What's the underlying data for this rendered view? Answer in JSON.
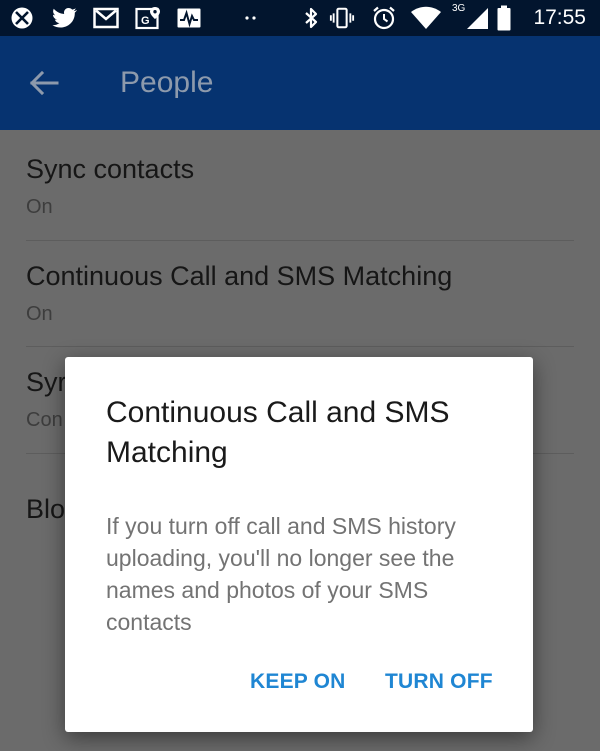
{
  "status_bar": {
    "time": "17:55",
    "network": "3G",
    "left_icons": [
      "xbox-icon",
      "twitter-icon",
      "gmail-icon",
      "google-maps-icon",
      "activity-icon",
      "more-notifications-icon"
    ],
    "right_icons": [
      "bluetooth-icon",
      "vibrate-icon",
      "alarm-icon",
      "wifi-icon",
      "signal-icon",
      "battery-icon"
    ]
  },
  "app_bar": {
    "title": "People",
    "back_icon": "arrow-back-icon"
  },
  "settings": [
    {
      "title": "Sync contacts",
      "subtitle": "On"
    },
    {
      "title": "Continuous Call and SMS Matching",
      "subtitle": "On"
    },
    {
      "title": "Syr",
      "subtitle": "Con"
    },
    {
      "title": "Blo",
      "subtitle": ""
    }
  ],
  "dialog": {
    "title": "Continuous Call and SMS Matching",
    "body": "If you turn off call and SMS history uploading, you'll no longer see the names and photos of your SMS contacts",
    "keep_on_label": "KEEP ON",
    "turn_off_label": "TURN OFF"
  },
  "colors": {
    "status_bar": "#02152e",
    "app_bar": "#063370",
    "title_dim": "#8d9aac",
    "scrim_content": "#6b6b6b",
    "accent": "#1f86d3"
  }
}
